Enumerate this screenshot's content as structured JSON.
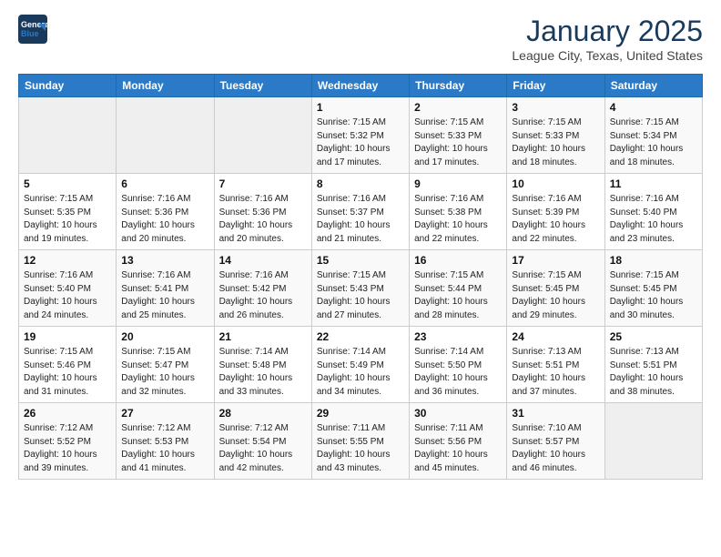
{
  "header": {
    "logo_line1": "General",
    "logo_line2": "Blue",
    "month": "January 2025",
    "location": "League City, Texas, United States"
  },
  "weekdays": [
    "Sunday",
    "Monday",
    "Tuesday",
    "Wednesday",
    "Thursday",
    "Friday",
    "Saturday"
  ],
  "weeks": [
    [
      {
        "day": "",
        "empty": true
      },
      {
        "day": "",
        "empty": true
      },
      {
        "day": "",
        "empty": true
      },
      {
        "day": "1",
        "sunrise": "7:15 AM",
        "sunset": "5:32 PM",
        "daylight": "10 hours and 17 minutes."
      },
      {
        "day": "2",
        "sunrise": "7:15 AM",
        "sunset": "5:33 PM",
        "daylight": "10 hours and 17 minutes."
      },
      {
        "day": "3",
        "sunrise": "7:15 AM",
        "sunset": "5:33 PM",
        "daylight": "10 hours and 18 minutes."
      },
      {
        "day": "4",
        "sunrise": "7:15 AM",
        "sunset": "5:34 PM",
        "daylight": "10 hours and 18 minutes."
      }
    ],
    [
      {
        "day": "5",
        "sunrise": "7:15 AM",
        "sunset": "5:35 PM",
        "daylight": "10 hours and 19 minutes."
      },
      {
        "day": "6",
        "sunrise": "7:16 AM",
        "sunset": "5:36 PM",
        "daylight": "10 hours and 20 minutes."
      },
      {
        "day": "7",
        "sunrise": "7:16 AM",
        "sunset": "5:36 PM",
        "daylight": "10 hours and 20 minutes."
      },
      {
        "day": "8",
        "sunrise": "7:16 AM",
        "sunset": "5:37 PM",
        "daylight": "10 hours and 21 minutes."
      },
      {
        "day": "9",
        "sunrise": "7:16 AM",
        "sunset": "5:38 PM",
        "daylight": "10 hours and 22 minutes."
      },
      {
        "day": "10",
        "sunrise": "7:16 AM",
        "sunset": "5:39 PM",
        "daylight": "10 hours and 22 minutes."
      },
      {
        "day": "11",
        "sunrise": "7:16 AM",
        "sunset": "5:40 PM",
        "daylight": "10 hours and 23 minutes."
      }
    ],
    [
      {
        "day": "12",
        "sunrise": "7:16 AM",
        "sunset": "5:40 PM",
        "daylight": "10 hours and 24 minutes."
      },
      {
        "day": "13",
        "sunrise": "7:16 AM",
        "sunset": "5:41 PM",
        "daylight": "10 hours and 25 minutes."
      },
      {
        "day": "14",
        "sunrise": "7:16 AM",
        "sunset": "5:42 PM",
        "daylight": "10 hours and 26 minutes."
      },
      {
        "day": "15",
        "sunrise": "7:15 AM",
        "sunset": "5:43 PM",
        "daylight": "10 hours and 27 minutes."
      },
      {
        "day": "16",
        "sunrise": "7:15 AM",
        "sunset": "5:44 PM",
        "daylight": "10 hours and 28 minutes."
      },
      {
        "day": "17",
        "sunrise": "7:15 AM",
        "sunset": "5:45 PM",
        "daylight": "10 hours and 29 minutes."
      },
      {
        "day": "18",
        "sunrise": "7:15 AM",
        "sunset": "5:45 PM",
        "daylight": "10 hours and 30 minutes."
      }
    ],
    [
      {
        "day": "19",
        "sunrise": "7:15 AM",
        "sunset": "5:46 PM",
        "daylight": "10 hours and 31 minutes."
      },
      {
        "day": "20",
        "sunrise": "7:15 AM",
        "sunset": "5:47 PM",
        "daylight": "10 hours and 32 minutes."
      },
      {
        "day": "21",
        "sunrise": "7:14 AM",
        "sunset": "5:48 PM",
        "daylight": "10 hours and 33 minutes."
      },
      {
        "day": "22",
        "sunrise": "7:14 AM",
        "sunset": "5:49 PM",
        "daylight": "10 hours and 34 minutes."
      },
      {
        "day": "23",
        "sunrise": "7:14 AM",
        "sunset": "5:50 PM",
        "daylight": "10 hours and 36 minutes."
      },
      {
        "day": "24",
        "sunrise": "7:13 AM",
        "sunset": "5:51 PM",
        "daylight": "10 hours and 37 minutes."
      },
      {
        "day": "25",
        "sunrise": "7:13 AM",
        "sunset": "5:51 PM",
        "daylight": "10 hours and 38 minutes."
      }
    ],
    [
      {
        "day": "26",
        "sunrise": "7:12 AM",
        "sunset": "5:52 PM",
        "daylight": "10 hours and 39 minutes."
      },
      {
        "day": "27",
        "sunrise": "7:12 AM",
        "sunset": "5:53 PM",
        "daylight": "10 hours and 41 minutes."
      },
      {
        "day": "28",
        "sunrise": "7:12 AM",
        "sunset": "5:54 PM",
        "daylight": "10 hours and 42 minutes."
      },
      {
        "day": "29",
        "sunrise": "7:11 AM",
        "sunset": "5:55 PM",
        "daylight": "10 hours and 43 minutes."
      },
      {
        "day": "30",
        "sunrise": "7:11 AM",
        "sunset": "5:56 PM",
        "daylight": "10 hours and 45 minutes."
      },
      {
        "day": "31",
        "sunrise": "7:10 AM",
        "sunset": "5:57 PM",
        "daylight": "10 hours and 46 minutes."
      },
      {
        "day": "",
        "empty": true
      }
    ]
  ],
  "labels": {
    "sunrise": "Sunrise:",
    "sunset": "Sunset:",
    "daylight": "Daylight:"
  }
}
